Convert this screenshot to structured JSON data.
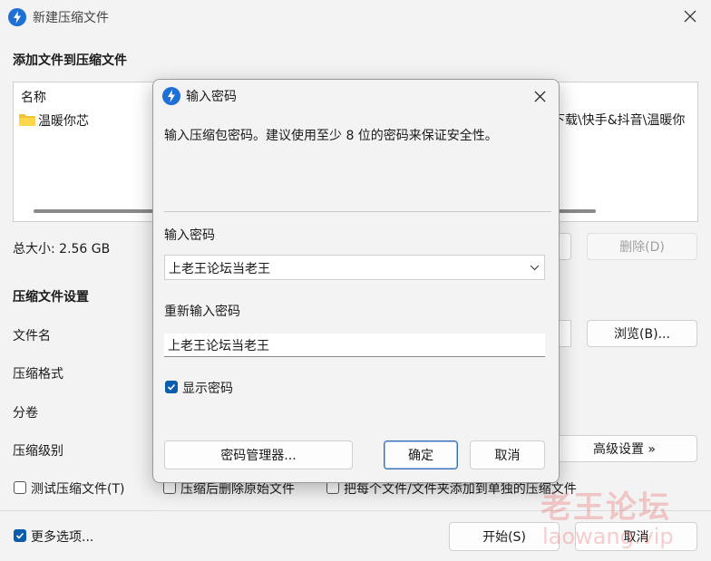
{
  "window": {
    "title": "新建压缩文件",
    "close_glyph": "✕"
  },
  "main": {
    "section_title": "添加文件到压缩文件",
    "file_list": {
      "header": "名称",
      "items": [
        {
          "name": "温暖你芯"
        }
      ],
      "path_fragment": "下载\\快手&抖音\\温暖你"
    },
    "total_size": "总大小: 2.56 GB",
    "delete_button": "删除(D)",
    "settings_title": "压缩文件设置",
    "filename_label": "文件名",
    "browse_button": "浏览(B)...",
    "format_label": "压缩格式",
    "volume_label": "分卷",
    "level_label": "压缩级别",
    "advanced_button": "高级设置 »",
    "test_checkbox": "测试压缩文件(T)",
    "delete_after_checkbox": "压缩后删除原始文件",
    "each_file_checkbox": "把每个文件/文件夹添加到单独的压缩文件",
    "more_options_checkbox": "更多选项...",
    "start_button": "开始(S)",
    "cancel_button": "取消"
  },
  "dialog": {
    "title": "输入密码",
    "close_glyph": "✕",
    "description": "输入压缩包密码。建议使用至少 8 位的密码来保证安全性。",
    "password_label": "输入密码",
    "password_value": "上老王论坛当老王",
    "confirm_label": "重新输入密码",
    "confirm_value": "上老王论坛当老王",
    "show_password": "显示密码",
    "manager_button": "密码管理器...",
    "ok_button": "确定",
    "cancel_button": "取消"
  },
  "watermark": {
    "line1": "老王论坛",
    "line2": "laowang.vip"
  },
  "colors": {
    "accent": "#0b5cad",
    "app_icon": "#1e6fd6",
    "watermark": "#e65050"
  },
  "icons": {
    "app": "lightning-bolt-icon",
    "folder": "folder-icon",
    "close": "close-icon",
    "dropdown": "chevron-down-icon",
    "check": "checkmark-icon"
  }
}
